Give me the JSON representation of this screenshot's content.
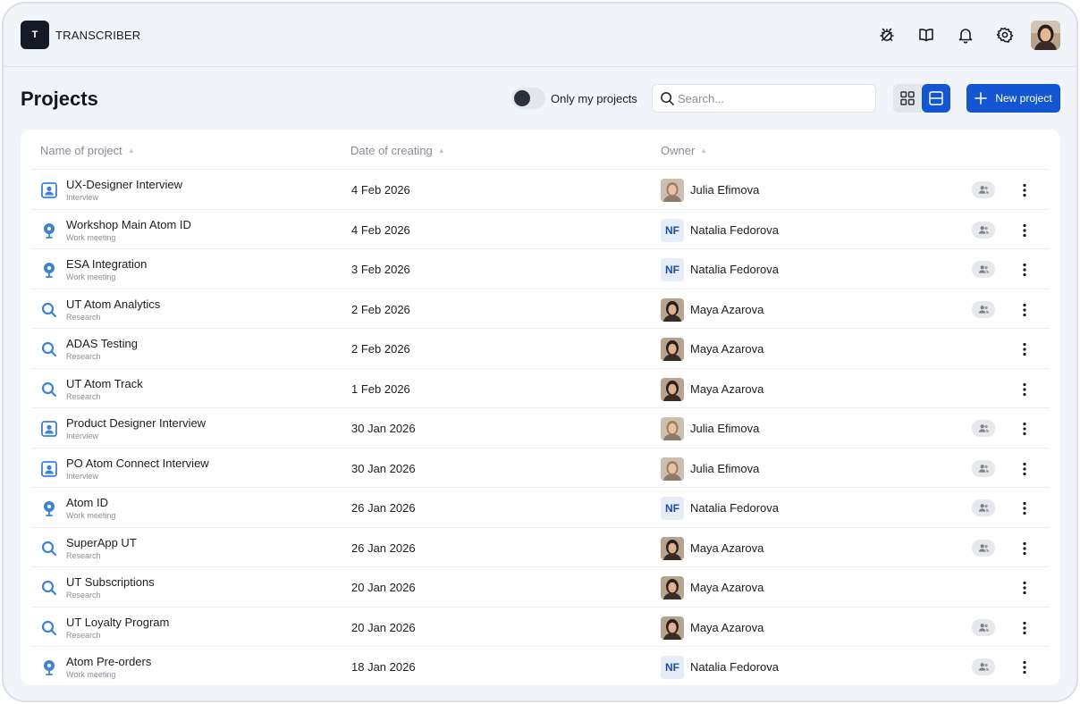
{
  "app": {
    "logo_letter": "T",
    "name": "TRANSCRIBER"
  },
  "header_icons": [
    "bug-icon",
    "book-icon",
    "bell-icon",
    "gear-icon"
  ],
  "page": {
    "title": "Projects"
  },
  "filter": {
    "toggle_label": "Only my projects",
    "toggle_on": false
  },
  "search": {
    "placeholder": "Search..."
  },
  "view": {
    "active": "list"
  },
  "new_project_label": "New project",
  "table": {
    "headers": {
      "name": "Name of project",
      "date": "Date of creating",
      "owner": "Owner"
    },
    "rows": [
      {
        "name": "UX-Designer Interview",
        "type": "Interview",
        "icon": "interview",
        "date": "4 Feb 2026",
        "owner": "Julia Efimova",
        "owner_avatar": "julia",
        "shared": true
      },
      {
        "name": "Workshop Main Atom ID",
        "type": "Work meeting",
        "icon": "meeting",
        "date": "4 Feb 2026",
        "owner": "Natalia Fedorova",
        "owner_initials": "NF",
        "shared": true
      },
      {
        "name": "ESA Integration",
        "type": "Work meeting",
        "icon": "meeting",
        "date": "3 Feb 2026",
        "owner": "Natalia Fedorova",
        "owner_initials": "NF",
        "shared": true
      },
      {
        "name": "UT Atom Analytics",
        "type": "Research",
        "icon": "research",
        "date": "2 Feb 2026",
        "owner": "Maya Azarova",
        "owner_avatar": "maya",
        "shared": true
      },
      {
        "name": "ADAS Testing",
        "type": "Research",
        "icon": "research",
        "date": "2 Feb 2026",
        "owner": "Maya Azarova",
        "owner_avatar": "maya",
        "shared": false
      },
      {
        "name": "UT Atom Track",
        "type": "Research",
        "icon": "research",
        "date": "1 Feb 2026",
        "owner": "Maya Azarova",
        "owner_avatar": "maya",
        "shared": false
      },
      {
        "name": "Product Designer Interview",
        "type": "Interview",
        "icon": "interview",
        "date": "30 Jan 2026",
        "owner": "Julia Efimova",
        "owner_avatar": "julia",
        "shared": true
      },
      {
        "name": "PO Atom Connect Interview",
        "type": "Interview",
        "icon": "interview",
        "date": "30 Jan 2026",
        "owner": "Julia Efimova",
        "owner_avatar": "julia",
        "shared": true
      },
      {
        "name": "Atom ID",
        "type": "Work meeting",
        "icon": "meeting",
        "date": "26 Jan 2026",
        "owner": "Natalia Fedorova",
        "owner_initials": "NF",
        "shared": true
      },
      {
        "name": "SuperApp UT",
        "type": "Research",
        "icon": "research",
        "date": "26 Jan 2026",
        "owner": "Maya Azarova",
        "owner_avatar": "maya",
        "shared": true
      },
      {
        "name": "UT Subscriptions",
        "type": "Research",
        "icon": "research",
        "date": "20 Jan 2026",
        "owner": "Maya Azarova",
        "owner_avatar": "maya",
        "shared": false
      },
      {
        "name": "UT Loyalty Program",
        "type": "Research",
        "icon": "research",
        "date": "20 Jan 2026",
        "owner": "Maya Azarova",
        "owner_avatar": "maya",
        "shared": true
      },
      {
        "name": "Atom Pre-orders",
        "type": "Work meeting",
        "icon": "meeting",
        "date": "18 Jan 2026",
        "owner": "Natalia Fedorova",
        "owner_initials": "NF",
        "shared": true
      }
    ]
  },
  "colors": {
    "accent": "#1456d1",
    "icon_blue": "#3b82d6",
    "background": "#f1f4f8"
  }
}
